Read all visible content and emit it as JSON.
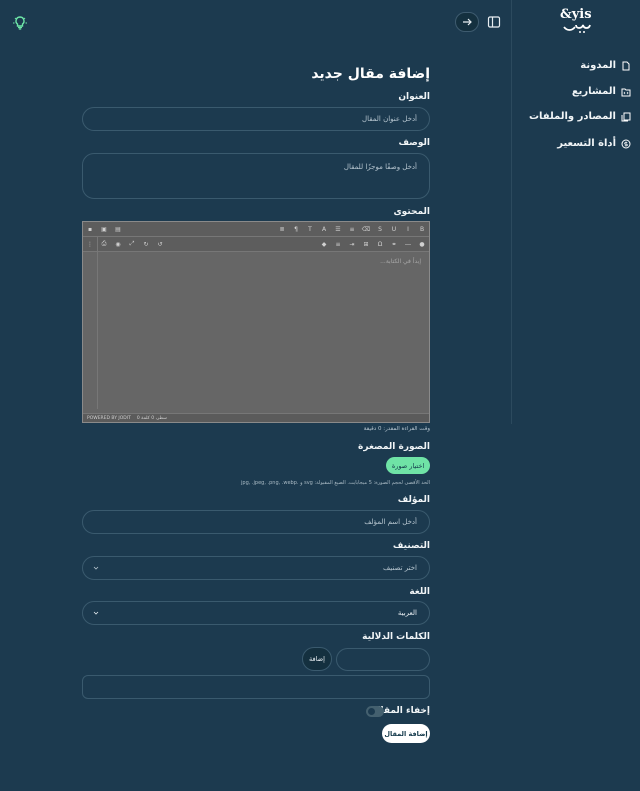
{
  "topbar": {
    "theme_icon": "lightbulb-icon",
    "forward_icon": "arrow-right-icon",
    "panel_icon": "sidebar-toggle-icon"
  },
  "sidebar": {
    "logo_text": "yis يس",
    "items": [
      {
        "label": "المدونة",
        "icon": "document-icon"
      },
      {
        "label": "المشاريع",
        "icon": "folder-code-icon"
      },
      {
        "label": "المصادر والملفات",
        "icon": "files-icon"
      },
      {
        "label": "أداة التسعير",
        "icon": "dollar-circle-icon"
      }
    ]
  },
  "form": {
    "page_title": "إضافة مقال جديد",
    "title_label": "العنوان",
    "title_placeholder": "أدخل عنوان المقال",
    "desc_label": "الوصف",
    "desc_placeholder": "أدخل وصفًا موجزًا للمقال",
    "content_label": "المحتوى",
    "editor_placeholder": "إبدأ في الكتابة...",
    "editor_status_left": "POWERED BY JODIT",
    "editor_status_counts": "0 سطر، 0 كلمة",
    "read_time": "وقت القراءة المقدر: 0 دقيقة",
    "thumb_label": "الصورة المصغرة",
    "choose_image": "اختيار صورة",
    "image_hint": "الحد الأقصى لحجم الصورة: 5 ميجابايت. الصيغ المقبولة: svg و .jpg, .jpeg, .png, .webp",
    "author_label": "المؤلف",
    "author_placeholder": "أدخل اسم المؤلف",
    "category_label": "التصنيف",
    "category_placeholder": "اختر تصنيف",
    "language_label": "اللغة",
    "language_value": "العربية",
    "keywords_label": "الكلمات الدلالية",
    "add_keyword": "إضافة",
    "hide_label": "إخفاء المقال",
    "submit": "إضافة المقال"
  }
}
